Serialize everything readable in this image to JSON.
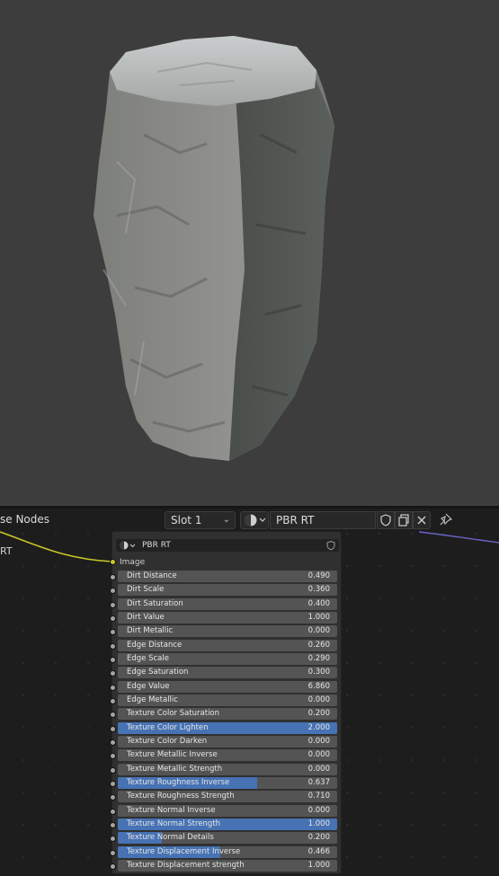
{
  "editor": {
    "title": "se Nodes",
    "slot": "Slot 1",
    "material": "PBR RT",
    "left_label": "RT"
  },
  "node": {
    "name": "PBR RT",
    "image_label": "Image",
    "rows": [
      {
        "label": "Dirt Distance",
        "value": "0.490",
        "fill": 0
      },
      {
        "label": "Dirt Scale",
        "value": "0.360",
        "fill": 0
      },
      {
        "label": "Dirt Saturation",
        "value": "0.400",
        "fill": 0
      },
      {
        "label": "Dirt Value",
        "value": "1.000",
        "fill": 0
      },
      {
        "label": "Dirt Metallic",
        "value": "0.000",
        "fill": 0
      },
      {
        "label": "Edge Distance",
        "value": "0.260",
        "fill": 0
      },
      {
        "label": "Edge Scale",
        "value": "0.290",
        "fill": 0
      },
      {
        "label": "Edge Saturation",
        "value": "0.300",
        "fill": 0
      },
      {
        "label": "Edge Value",
        "value": "6.860",
        "fill": 0
      },
      {
        "label": "Edge Metallic",
        "value": "0.000",
        "fill": 0
      },
      {
        "label": "Texture Color Saturation",
        "value": "0.200",
        "fill": 0
      },
      {
        "label": "Texture Color Lighten",
        "value": "2.000",
        "fill": 1
      },
      {
        "label": "Texture Color Darken",
        "value": "0.000",
        "fill": 0
      },
      {
        "label": "Texture Metallic Inverse",
        "value": "0.000",
        "fill": 0
      },
      {
        "label": "Texture Metallic Strength",
        "value": "0.000",
        "fill": 0
      },
      {
        "label": "Texture Roughness Inverse",
        "value": "0.637",
        "fill": 0.637
      },
      {
        "label": "Texture Roughness Strength",
        "value": "0.710",
        "fill": 0
      },
      {
        "label": "Texture Normal Inverse",
        "value": "0.000",
        "fill": 0
      },
      {
        "label": "Texture Normal Strength",
        "value": "1.000",
        "fill": 1
      },
      {
        "label": "Texture Normal Details",
        "value": "0.200",
        "fill": 0.2
      },
      {
        "label": "Texture Displacement Inverse",
        "value": "0.466",
        "fill": 0.466
      },
      {
        "label": "Texture Displacement strength",
        "value": "1.000",
        "fill": 0
      }
    ]
  },
  "colors": {
    "accent": "#4772b3",
    "viewport_bg": "#3d3d3d",
    "editor_bg": "#1d1d1d",
    "field_bg": "#545454",
    "image_socket": "#c7c729",
    "wire_purple": "#6a63c9"
  },
  "icons": {
    "material_sphere": "material-sphere-icon",
    "fake_user": "shield-icon",
    "duplicate": "duplicate-icon",
    "unlink": "close-icon",
    "pin": "pin-icon"
  }
}
